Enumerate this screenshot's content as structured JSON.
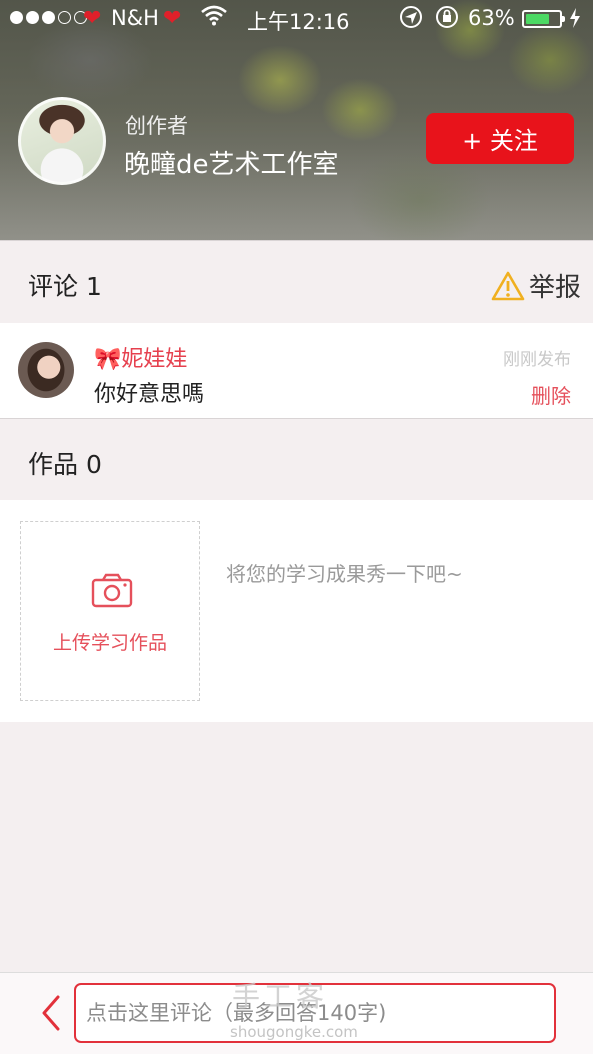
{
  "status_bar": {
    "carrier": "N&H",
    "time": "上午12:16",
    "battery_percent": "63%",
    "signal_bars_filled": 3,
    "signal_bars_total": 5
  },
  "profile": {
    "creator_label": "创作者",
    "creator_name": "晚疃de艺术工作室",
    "follow_label": "+ 关注"
  },
  "comments_section": {
    "title": "评论 1",
    "report_label": "举报"
  },
  "comment": {
    "user_name": "🎀妮娃娃",
    "text": "你好意思嗎",
    "time": "刚刚发布",
    "delete_label": "删除"
  },
  "works_section": {
    "title": "作品 0",
    "upload_label": "上传学习作品",
    "hint": "将您的学习成果秀一下吧~"
  },
  "bottom_bar": {
    "input_placeholder": "点击这里评论（最多回答140字)"
  },
  "watermark": {
    "main": "手工客",
    "sub": "shougongke.com"
  },
  "colors": {
    "accent": "#e8131b",
    "pink_text": "#e6404e",
    "warning": "#f0b020"
  }
}
